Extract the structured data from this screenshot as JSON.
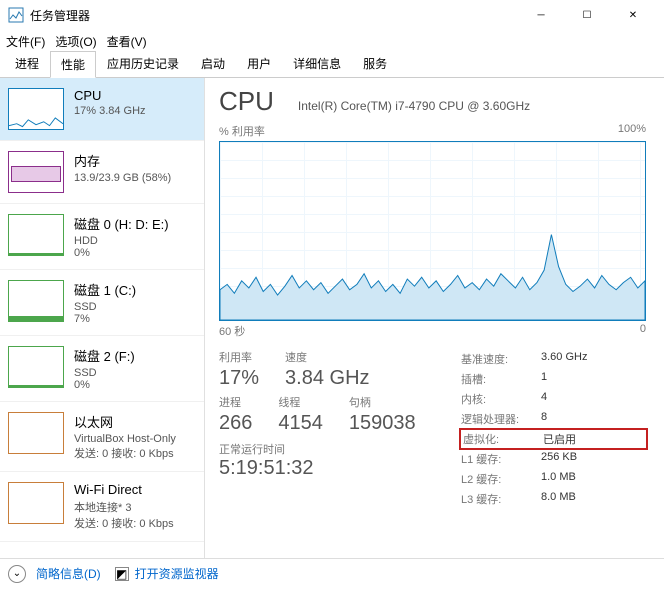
{
  "window": {
    "title": "任务管理器"
  },
  "menus": {
    "file": "文件(F)",
    "options": "选项(O)",
    "view": "查看(V)"
  },
  "tabs": {
    "processes": "进程",
    "performance": "性能",
    "history": "应用历史记录",
    "startup": "启动",
    "users": "用户",
    "details": "详细信息",
    "services": "服务"
  },
  "sidebar": {
    "cpu": {
      "name": "CPU",
      "sub": "17% 3.84 GHz"
    },
    "mem": {
      "name": "内存",
      "sub": "13.9/23.9 GB (58%)"
    },
    "disk0": {
      "name": "磁盘 0 (H: D: E:)",
      "sub1": "HDD",
      "sub2": "0%"
    },
    "disk1": {
      "name": "磁盘 1 (C:)",
      "sub1": "SSD",
      "sub2": "7%"
    },
    "disk2": {
      "name": "磁盘 2 (F:)",
      "sub1": "SSD",
      "sub2": "0%"
    },
    "eth": {
      "name": "以太网",
      "sub1": "VirtualBox Host-Only",
      "sub2": "发送: 0 接收: 0 Kbps"
    },
    "wifi": {
      "name": "Wi-Fi Direct",
      "sub1": "本地连接* 3",
      "sub2": "发送: 0 接收: 0 Kbps"
    }
  },
  "detail": {
    "title": "CPU",
    "model": "Intel(R) Core(TM) i7-4790 CPU @ 3.60GHz",
    "chart_top_left": "% 利用率",
    "chart_top_right": "100%",
    "chart_bottom_left": "60 秒",
    "chart_bottom_right": "0",
    "util_lbl": "利用率",
    "util_val": "17%",
    "speed_lbl": "速度",
    "speed_val": "3.84 GHz",
    "proc_lbl": "进程",
    "proc_val": "266",
    "thread_lbl": "线程",
    "thread_val": "4154",
    "handle_lbl": "句柄",
    "handle_val": "159038",
    "uptime_lbl": "正常运行时间",
    "uptime_val": "5:19:51:32",
    "spec": {
      "base_k": "基准速度:",
      "base_v": "3.60 GHz",
      "sockets_k": "插槽:",
      "sockets_v": "1",
      "cores_k": "内核:",
      "cores_v": "4",
      "lproc_k": "逻辑处理器:",
      "lproc_v": "8",
      "virt_k": "虚拟化:",
      "virt_v": "已启用",
      "l1_k": "L1 缓存:",
      "l1_v": "256 KB",
      "l2_k": "L2 缓存:",
      "l2_v": "1.0 MB",
      "l3_k": "L3 缓存:",
      "l3_v": "8.0 MB"
    }
  },
  "footer": {
    "brief": "简略信息(D)",
    "resmon": "打开资源监视器"
  },
  "chart_data": {
    "type": "line",
    "title": "% 利用率",
    "xlabel": "60 秒",
    "ylabel": "% 利用率",
    "ylim": [
      0,
      100
    ],
    "xlim_seconds": [
      60,
      0
    ],
    "values_pct": [
      17,
      20,
      15,
      22,
      18,
      24,
      16,
      20,
      14,
      19,
      25,
      18,
      22,
      17,
      21,
      15,
      19,
      23,
      17,
      20,
      26,
      18,
      22,
      16,
      20,
      15,
      23,
      19,
      24,
      18,
      22,
      16,
      20,
      25,
      18,
      21,
      17,
      23,
      19,
      26,
      22,
      18,
      24,
      17,
      21,
      28,
      48,
      30,
      20,
      16,
      19,
      23,
      18,
      25,
      20,
      17,
      21,
      24,
      18,
      22
    ]
  }
}
